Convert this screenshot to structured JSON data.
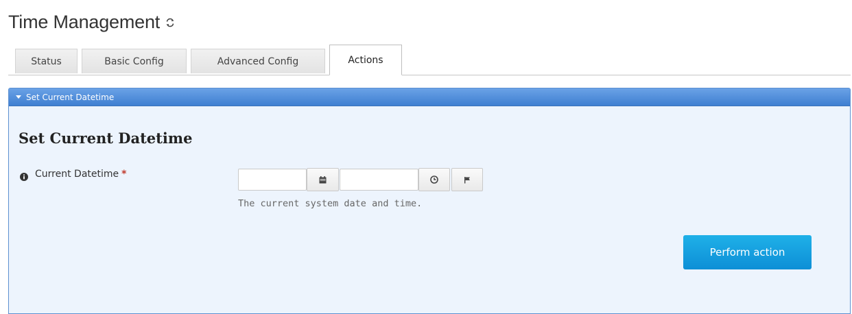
{
  "page": {
    "title": "Time Management"
  },
  "tabs": [
    {
      "label": "Status"
    },
    {
      "label": "Basic Config"
    },
    {
      "label": "Advanced Config"
    },
    {
      "label": "Actions",
      "active": true
    }
  ],
  "panel": {
    "header_label": "Set Current Datetime",
    "section_title": "Set Current Datetime",
    "field": {
      "label": "Current Datetime",
      "required_marker": "*",
      "date_value": "",
      "time_value": "",
      "help_text": "The current system date and time."
    },
    "action_button": "Perform action"
  },
  "icons": {
    "refresh": "refresh-icon",
    "calendar": "calendar-icon",
    "clock": "clock-icon",
    "flag": "flag-icon",
    "info": "info-icon",
    "caret": "caret-down-icon"
  },
  "colors": {
    "panel_header": "#3f7fd1",
    "panel_bg": "#edf4fd",
    "button": "#0d8fd6",
    "required": "#c0392b"
  }
}
